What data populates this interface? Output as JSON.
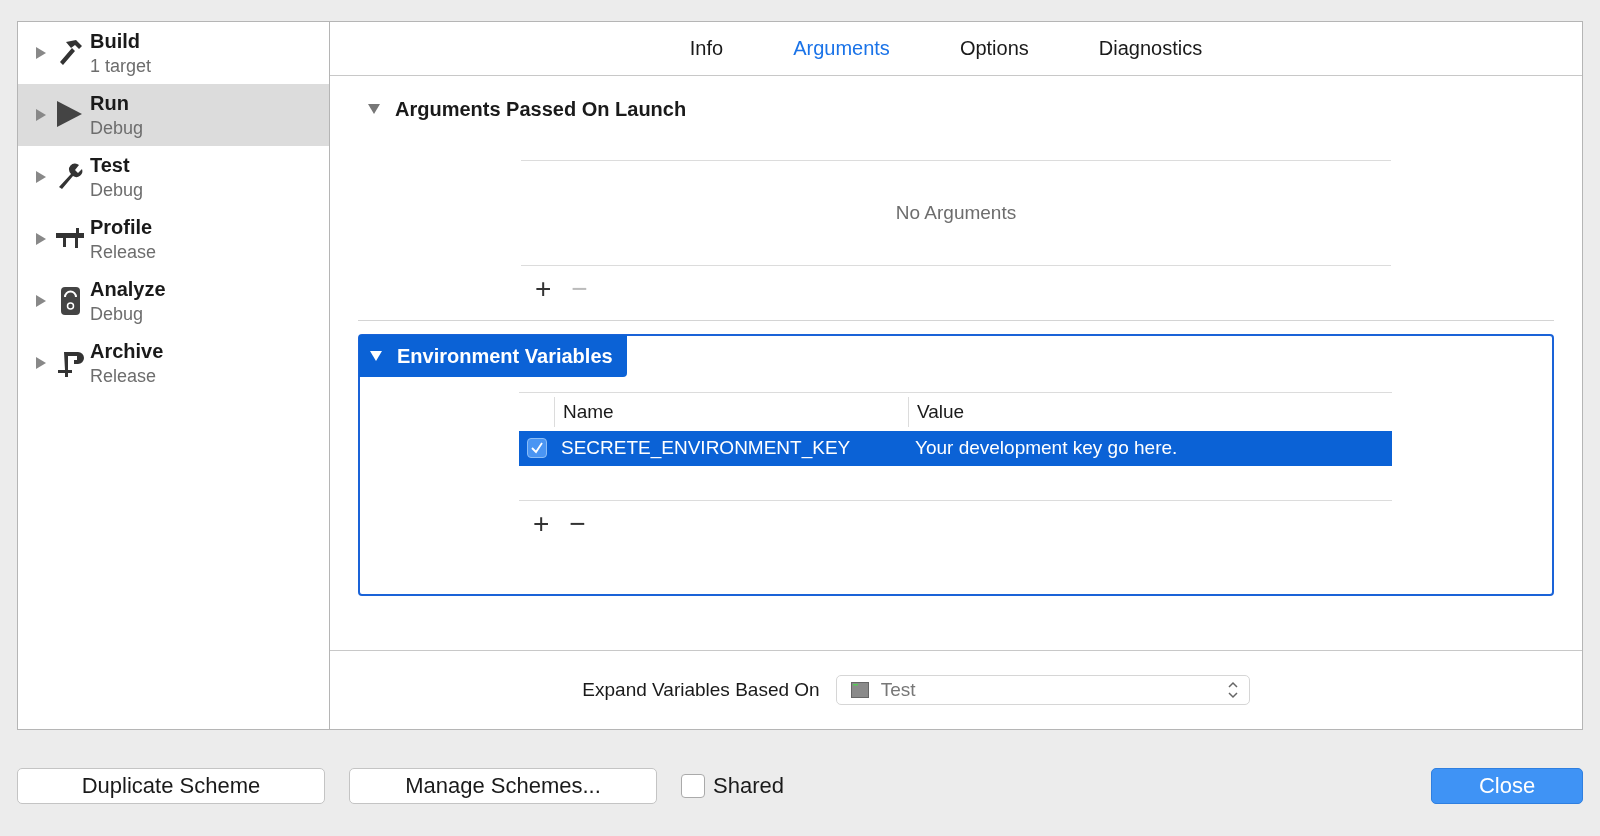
{
  "sidebar": {
    "items": [
      {
        "kind": "build",
        "title": "Build",
        "subtitle": "1 target",
        "selected": false,
        "expanded": false
      },
      {
        "kind": "run",
        "title": "Run",
        "subtitle": "Debug",
        "selected": true,
        "expanded": false
      },
      {
        "kind": "test",
        "title": "Test",
        "subtitle": "Debug",
        "selected": false,
        "expanded": false
      },
      {
        "kind": "profile",
        "title": "Profile",
        "subtitle": "Release",
        "selected": false,
        "expanded": false
      },
      {
        "kind": "analyze",
        "title": "Analyze",
        "subtitle": "Debug",
        "selected": false,
        "expanded": false
      },
      {
        "kind": "archive",
        "title": "Archive",
        "subtitle": "Release",
        "selected": false,
        "expanded": false
      }
    ]
  },
  "tabs": [
    {
      "label": "Info",
      "selected": false
    },
    {
      "label": "Arguments",
      "selected": true
    },
    {
      "label": "Options",
      "selected": false
    },
    {
      "label": "Diagnostics",
      "selected": false
    }
  ],
  "arguments_section": {
    "title": "Arguments Passed On Launch",
    "expanded": true,
    "focused": false,
    "empty_text": "No Arguments",
    "add_button": "+",
    "remove_button": "−",
    "remove_disabled": true
  },
  "environment_section": {
    "title": "Environment Variables",
    "expanded": true,
    "focused": true,
    "columns": [
      "Name",
      "Value"
    ],
    "rows": [
      {
        "checked": true,
        "selected": true,
        "name": "SECRETE_ENVIRONMENT_KEY",
        "value": "Your development key go here."
      }
    ],
    "add_button": "+",
    "remove_button": "−",
    "remove_disabled": false
  },
  "footer": {
    "label": "Expand Variables Based On",
    "popup": {
      "value": "Test"
    }
  },
  "bottom_bar": {
    "buttons": [
      "Duplicate Scheme",
      "Manage Schemes..."
    ],
    "shared": {
      "label": "Shared",
      "checked": false
    },
    "close_button": {
      "label": "Close",
      "default": true
    }
  }
}
